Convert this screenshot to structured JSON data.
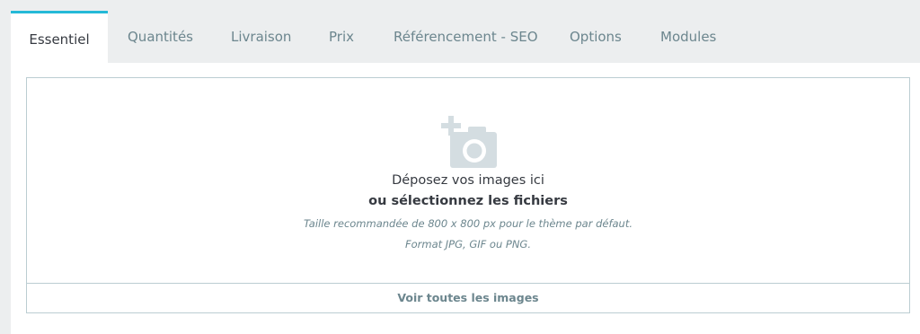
{
  "tabs": [
    {
      "label": "Essentiel",
      "active": true
    },
    {
      "label": "Quantités",
      "active": false
    },
    {
      "label": "Livraison",
      "active": false
    },
    {
      "label": "Prix",
      "active": false
    },
    {
      "label": "Référencement - SEO",
      "active": false
    },
    {
      "label": "Options",
      "active": false
    },
    {
      "label": "Modules",
      "active": false
    }
  ],
  "dropzone": {
    "icon": "add-photo-icon",
    "title": "Déposez vos images ici",
    "select_link": "ou sélectionnez les fichiers",
    "help_size": "Taille recommandée de 800 x 800 px pour le thème par défaut.",
    "help_format": "Format JPG, GIF ou PNG.",
    "view_all": "Voir toutes les images"
  },
  "colors": {
    "accent": "#25b9d7",
    "tab_bg": "#eceeef",
    "border": "#bbcdd2",
    "muted_text": "#6c868e",
    "text": "#363a41"
  }
}
